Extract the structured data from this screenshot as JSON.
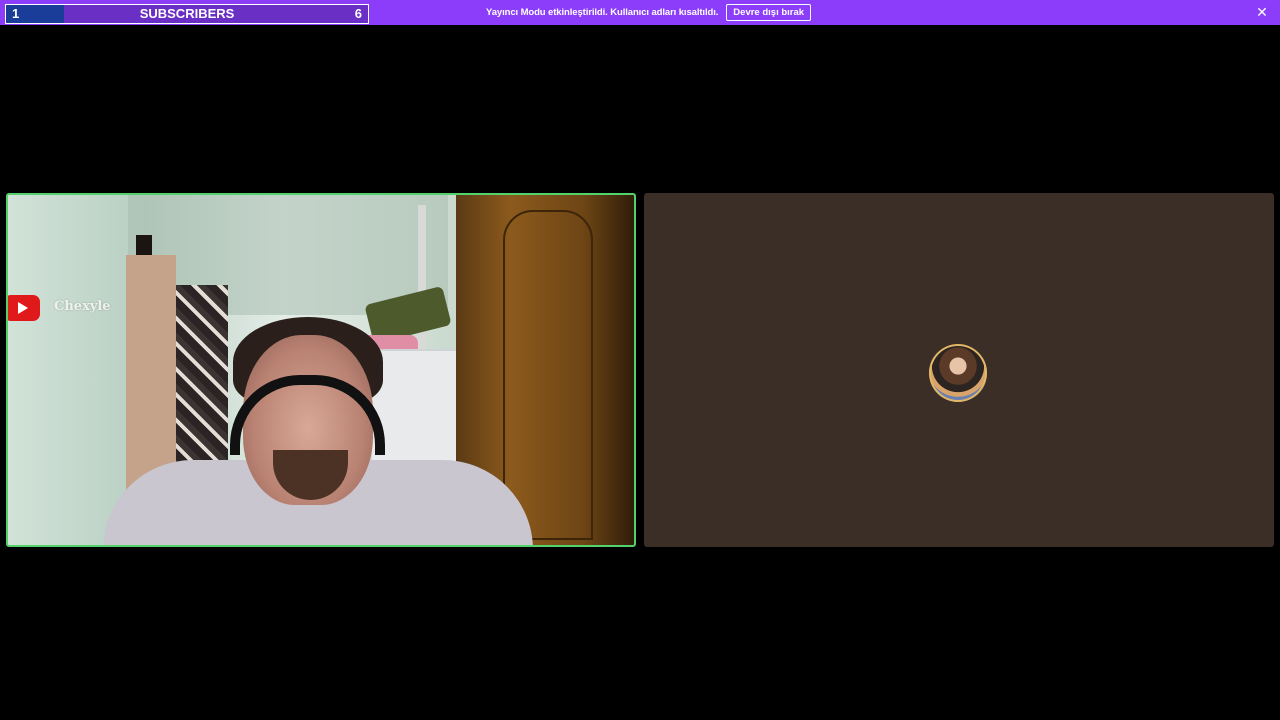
{
  "subscriber_goal": {
    "current": "1",
    "title": "SUBSCRIBERS",
    "goal": "6",
    "progress": 0.16
  },
  "banner": {
    "message": "Yayıncı Modu etkinleştirildi. Kullanıcı adları kısaltıldı.",
    "button_label": "Devre dışı bırak",
    "close_glyph": "✕",
    "background": "#8c3dfa"
  },
  "left_tile": {
    "stream_badge_icon": "youtube-icon",
    "overlay_name": "Chexyle",
    "speaking_border": "#53d16a"
  },
  "right_tile": {
    "background": "#3a2e27",
    "avatar_icon": "user-avatar"
  }
}
